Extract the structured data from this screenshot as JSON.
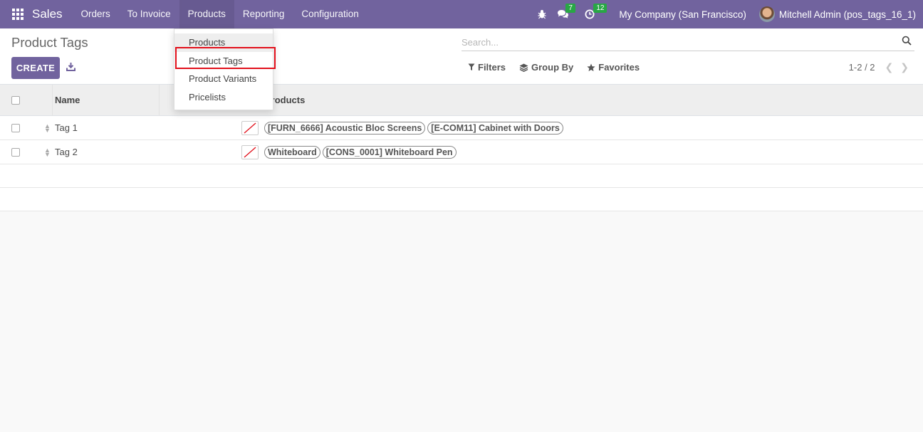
{
  "navbar": {
    "brand": "Sales",
    "menu": [
      "Orders",
      "To Invoice",
      "Products",
      "Reporting",
      "Configuration"
    ],
    "active_menu": "Products",
    "messages_count": "7",
    "activities_count": "12",
    "company": "My Company (San Francisco)",
    "user": "Mitchell Admin (pos_tags_16_1)",
    "brand_color": "#71639e"
  },
  "control_panel": {
    "title": "Product Tags",
    "create_label": "CREATE",
    "search_placeholder": "Search...",
    "filters_label": "Filters",
    "group_by_label": "Group By",
    "favorites_label": "Favorites",
    "pager": "1-2 / 2"
  },
  "dropdown": {
    "items": [
      "Products",
      "Product Tags",
      "Product Variants",
      "Pricelists"
    ],
    "highlighted": "Product Tags",
    "highlight_color": "#e2101b"
  },
  "table": {
    "columns": [
      "Name",
      "Products"
    ],
    "rows": [
      {
        "name": "Tag 1",
        "products": [
          "[FURN_6666] Acoustic Bloc Screens",
          "[E-COM11] Cabinet with Doors"
        ]
      },
      {
        "name": "Tag 2",
        "products": [
          "Whiteboard",
          "[CONS_0001] Whiteboard Pen"
        ]
      }
    ]
  }
}
